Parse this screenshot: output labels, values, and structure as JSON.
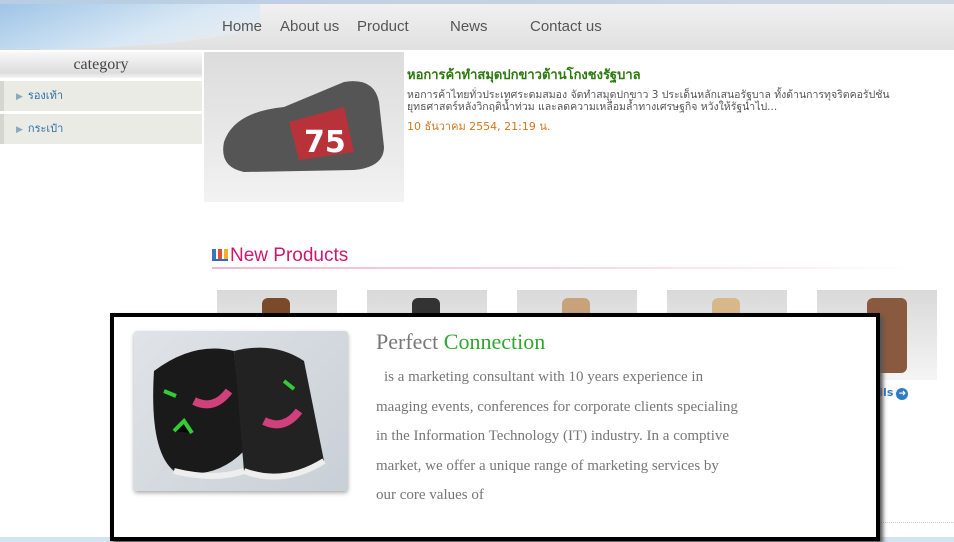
{
  "nav": {
    "items": [
      "Home",
      "About us",
      "Product",
      "News",
      "Contact us"
    ]
  },
  "sidebar": {
    "title": "category",
    "items": [
      "รองเท้า",
      "กระเป๋า"
    ]
  },
  "news": {
    "title": "หอการค้าทำสมุดปกขาวต้านโกงชงรัฐบาล",
    "body_line1": "หอการค้าไทยทั่วประเทศระดมสมอง จัดทำสมุดปกขาว 3 ประเด็นหลักเสนอรัฐบาล ทั้งด้านการทุจริตคอรัปชัน",
    "body_line2": "ยุทธศาสตร์หลังวิกฤติน้ำท่วม และลดความเหลื่อมล้ำทางเศรษฐกิจ หวังให้รัฐนำไป...",
    "date": "10 ธันวาคม 2554, 21:19 น."
  },
  "new_products": {
    "title": "New Products",
    "details_label": "Details"
  },
  "popup": {
    "title_gray": "Perfect",
    "title_green": "Connection",
    "body": [
      "is a marketing consultant with 10 years experience in",
      "maaging events, conferences for corporate clients specialing",
      "in the Information Technology (IT) industry. In a comptive",
      "market, we offer a unique range of marketing services by",
      "our core values of"
    ]
  },
  "colors": {
    "accent_pink": "#d0176f",
    "news_green": "#2c7a0e",
    "date_orange": "#d4761a",
    "link_blue": "#2e7bc4",
    "popup_green": "#2fa82f"
  }
}
